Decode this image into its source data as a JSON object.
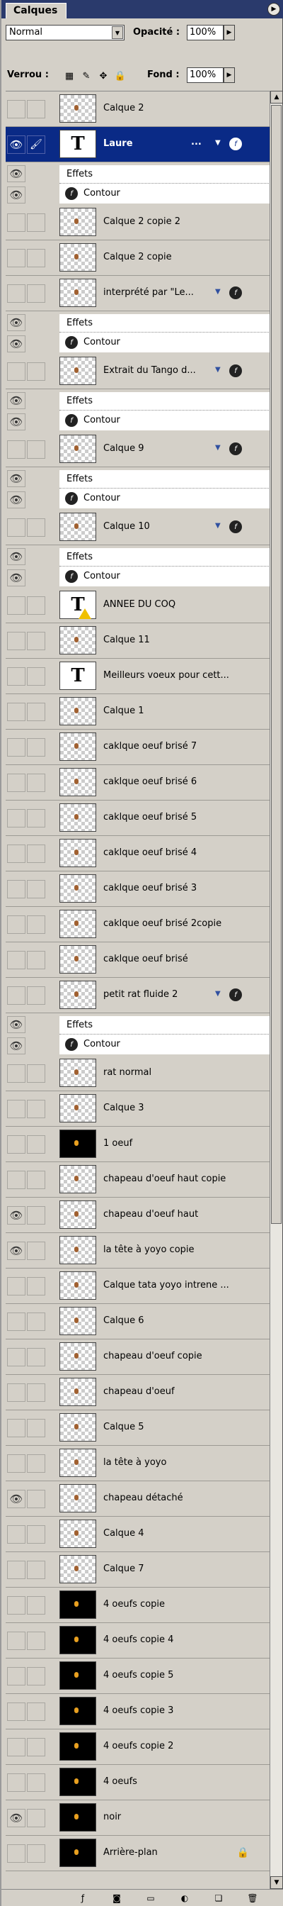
{
  "panel": {
    "tab_title": "Calques",
    "menu_icon": "triangle-right-icon"
  },
  "options": {
    "blend_mode": "Normal",
    "opacity_label": "Opacité :",
    "opacity_value": "100%",
    "lock_label": "Verrou :",
    "fill_label": "Fond :",
    "fill_value": "100%"
  },
  "layers": [
    {
      "name": "Calque 2",
      "thumb": "checker"
    },
    {
      "name": "Laure",
      "thumb": "text",
      "selected": true,
      "fx": true,
      "dots": "..."
    },
    {
      "name": "Calque 2 copie 2",
      "thumb": "checker"
    },
    {
      "name": "Calque 2 copie",
      "thumb": "checker"
    },
    {
      "name": "interprété par \"Le...",
      "thumb": "checker",
      "fx": true
    },
    {
      "name": "Extrait du Tango d...",
      "thumb": "checker",
      "fx": true
    },
    {
      "name": "Calque 9",
      "thumb": "checker",
      "fx": true
    },
    {
      "name": "Calque 10",
      "thumb": "checker",
      "fx": true
    },
    {
      "name": "ANNEE DU COQ",
      "thumb": "text-warning"
    },
    {
      "name": "Calque 11",
      "thumb": "checker"
    },
    {
      "name": "Meilleurs voeux pour cett...",
      "thumb": "text"
    },
    {
      "name": "Calque 1",
      "thumb": "checker"
    },
    {
      "name": "caklque oeuf brisé 7",
      "thumb": "checker"
    },
    {
      "name": "caklque oeuf brisé 6",
      "thumb": "checker"
    },
    {
      "name": "caklque oeuf brisé 5",
      "thumb": "checker"
    },
    {
      "name": "caklque oeuf brisé 4",
      "thumb": "checker"
    },
    {
      "name": "caklque oeuf brisé 3",
      "thumb": "checker"
    },
    {
      "name": "caklque oeuf brisé 2copie",
      "thumb": "checker"
    },
    {
      "name": "caklque oeuf brisé",
      "thumb": "checker"
    },
    {
      "name": "petit rat fluide 2",
      "thumb": "checker",
      "fx": true
    },
    {
      "name": "rat normal",
      "thumb": "checker"
    },
    {
      "name": "Calque 3",
      "thumb": "checker"
    },
    {
      "name": "1 oeuf",
      "thumb": "black"
    },
    {
      "name": "chapeau d'oeuf haut copie",
      "thumb": "checker"
    },
    {
      "name": "chapeau d'oeuf haut",
      "thumb": "checker",
      "visible": true
    },
    {
      "name": "la tête à yoyo copie",
      "thumb": "checker",
      "visible": true
    },
    {
      "name": "Calque tata yoyo intrene ...",
      "thumb": "checker"
    },
    {
      "name": "Calque 6",
      "thumb": "checker"
    },
    {
      "name": "chapeau d'oeuf copie",
      "thumb": "checker"
    },
    {
      "name": "chapeau d'oeuf",
      "thumb": "checker"
    },
    {
      "name": "Calque 5",
      "thumb": "checker"
    },
    {
      "name": "la tête à yoyo",
      "thumb": "checker"
    },
    {
      "name": "chapeau détaché",
      "thumb": "checker",
      "visible": true
    },
    {
      "name": "Calque 4",
      "thumb": "checker"
    },
    {
      "name": "Calque 7",
      "thumb": "checker"
    },
    {
      "name": "4 oeufs copie",
      "thumb": "black"
    },
    {
      "name": "4 oeufs copie 4",
      "thumb": "black"
    },
    {
      "name": "4 oeufs copie 5",
      "thumb": "black"
    },
    {
      "name": "4 oeufs copie 3",
      "thumb": "black"
    },
    {
      "name": "4 oeufs copie 2",
      "thumb": "black"
    },
    {
      "name": "4 oeufs",
      "thumb": "black"
    },
    {
      "name": "noir",
      "thumb": "black",
      "visible": true
    },
    {
      "name": "Arrière-plan",
      "thumb": "black",
      "locked": true
    }
  ],
  "effects_label": "Effets",
  "contour_label": "Contour",
  "bottom_icons": [
    "layer-style-icon",
    "mask-icon",
    "layer-set-icon",
    "adjustment-icon",
    "new-layer-icon",
    "trash-icon"
  ]
}
